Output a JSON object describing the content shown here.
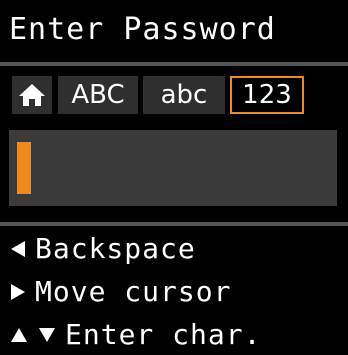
{
  "title": "Enter Password",
  "tabs": {
    "home_icon": "home-icon",
    "upper": "ABC",
    "lower": "abc",
    "numeric": "123"
  },
  "colors": {
    "accent": "#f08a1f",
    "tab_bg": "#2f2f2f",
    "field_bg": "#3a3a3a",
    "separator": "#555555"
  },
  "help": {
    "backspace": "Backspace",
    "move_cursor": "Move cursor",
    "enter_char": "Enter char."
  }
}
